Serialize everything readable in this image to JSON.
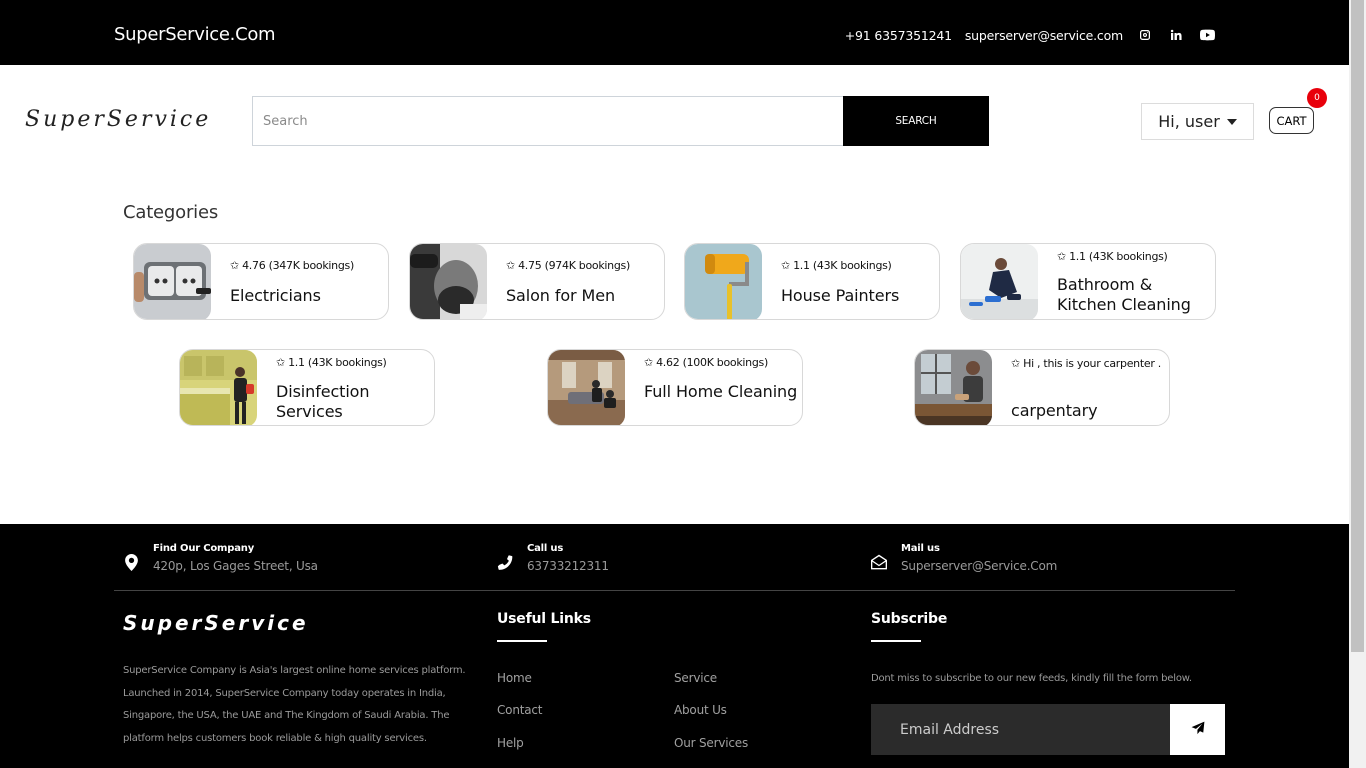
{
  "topbar": {
    "brand": "SuperService.Com",
    "phone": "+91 6357351241",
    "email": "superserver@service.com",
    "social_icons": [
      "instagram-icon",
      "linkedin-icon",
      "youtube-icon"
    ]
  },
  "header": {
    "logo": "SuperService",
    "search_placeholder": "Search",
    "search_button": "SEARCH",
    "user_label": "Hi, user",
    "cart_label": "CART",
    "cart_count": "0"
  },
  "categories": {
    "title": "Categories",
    "items": [
      {
        "rating": "✩ 4.76 (347K bookings)",
        "name": "Electricians",
        "thumb": "socket"
      },
      {
        "rating": "✩ 4.75 (974K bookings)",
        "name": "Salon for Men",
        "thumb": "salon"
      },
      {
        "rating": "✩ 1.1 (43K bookings)",
        "name": "House Painters",
        "thumb": "roller"
      },
      {
        "rating": "✩ 1.1 (43K bookings)",
        "name": "Bathroom & Kitchen Cleaning",
        "thumb": "cleaning"
      },
      {
        "rating": "✩ 1.1 (43K bookings)",
        "name": "Disinfection Services",
        "thumb": "kitchen"
      },
      {
        "rating": "✩ 4.62 (100K bookings)",
        "name": "Full Home Cleaning",
        "thumb": "livingroom"
      },
      {
        "rating": "✩ Hi , this is your carpenter .",
        "name": "carpentary",
        "thumb": "carpenter"
      }
    ]
  },
  "footer": {
    "info": [
      {
        "label": "Find Our Company",
        "value": "420p, Los Gages Street, Usa",
        "icon": "map-pin-icon"
      },
      {
        "label": "Call us",
        "value": "63733212311",
        "icon": "phone-icon"
      },
      {
        "label": "Mail us",
        "value": "Superserver@Service.Com",
        "icon": "mail-open-icon"
      }
    ],
    "logo": "SuperService",
    "about": "SuperService Company is Asia's largest online home services platform. Launched in 2014, SuperService Company today operates in India, Singapore, the USA, the UAE and The Kingdom of Saudi Arabia. The platform helps customers book reliable & high quality services.",
    "useful_links_title": "Useful Links",
    "links": [
      "Home",
      "Service",
      "Contact",
      "About Us",
      "Help",
      "Our Services"
    ],
    "subscribe_title": "Subscribe",
    "subscribe_text": "Dont miss to subscribe to our new feeds, kindly fill the form below.",
    "email_placeholder": "Email Address"
  },
  "colors": {
    "topbar_bg": "#000000",
    "footer_bg": "#000000",
    "cart_badge": "#e8000b",
    "footer_muted_text": "#9a9a9a"
  }
}
